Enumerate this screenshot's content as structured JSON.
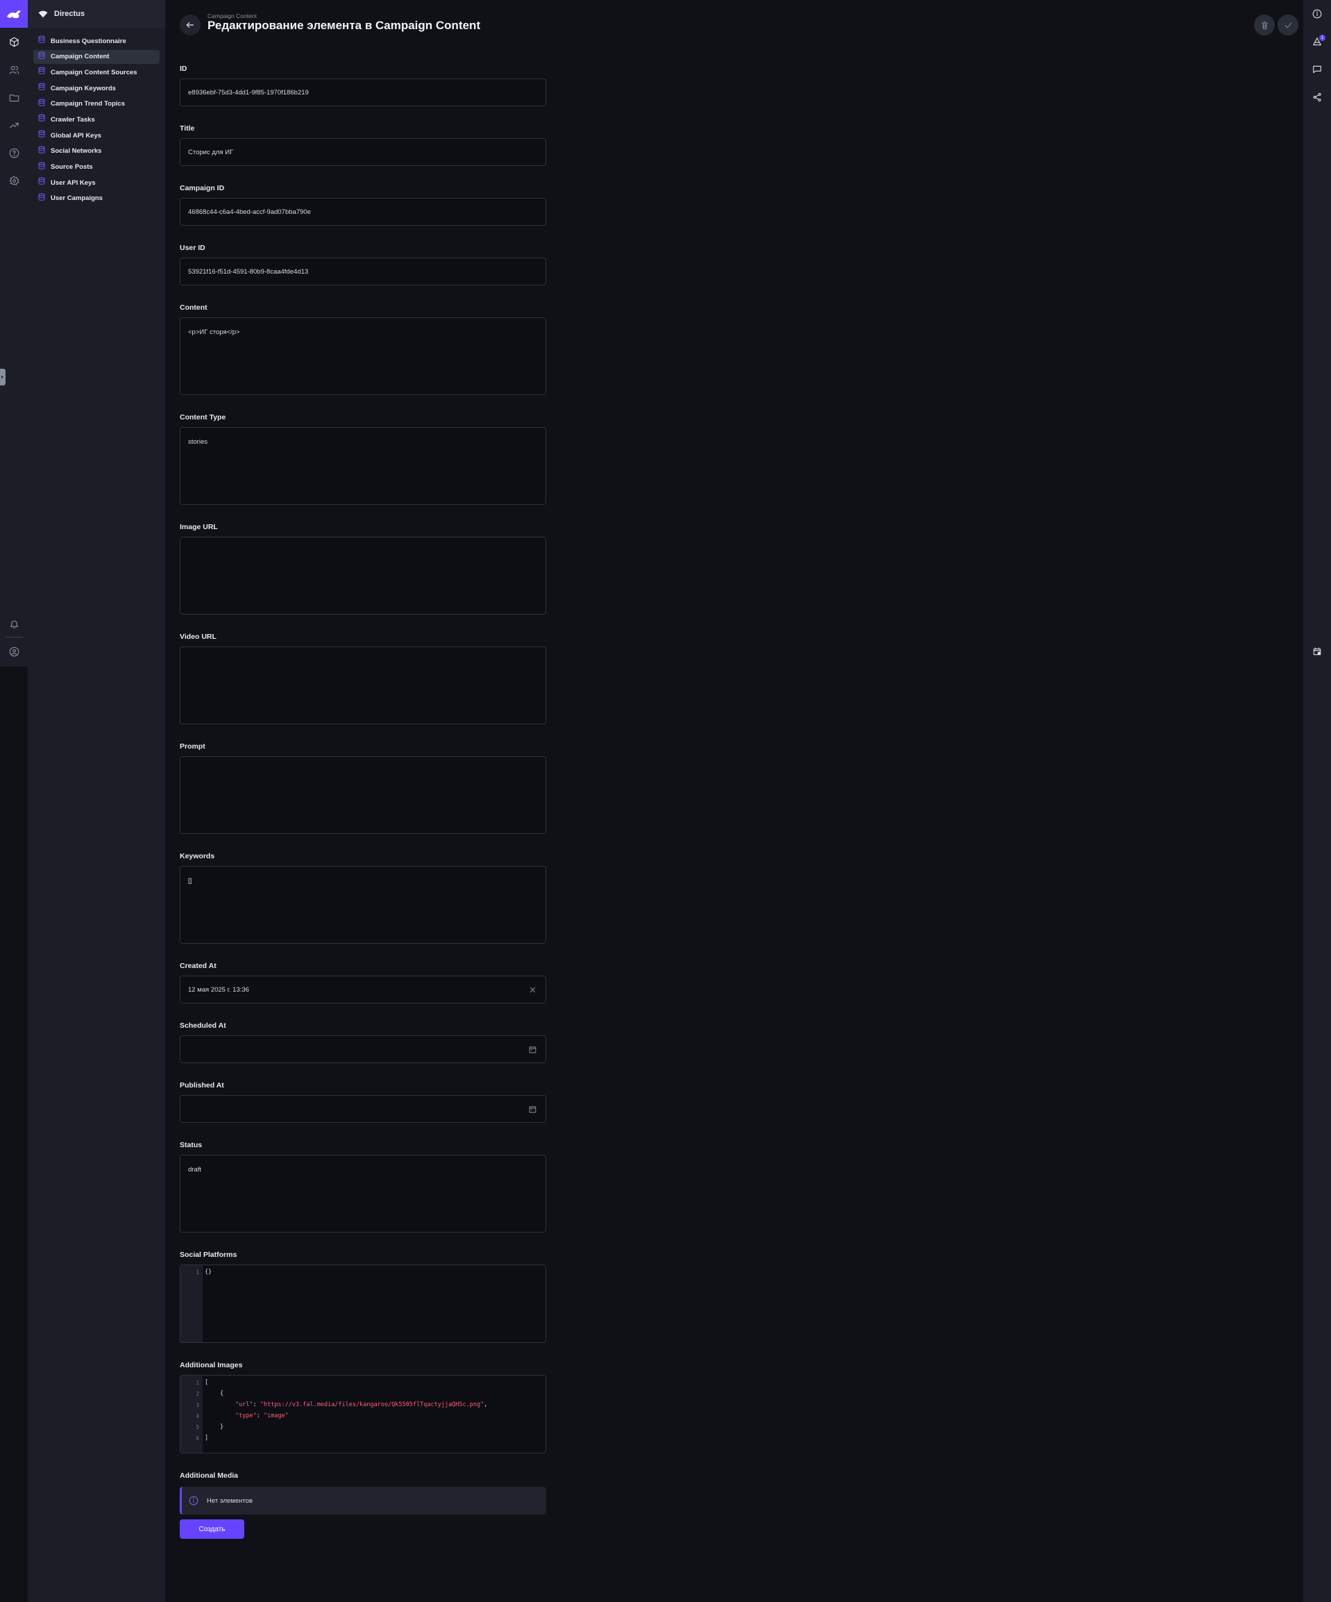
{
  "app": {
    "project_name": "Directus"
  },
  "nav": {
    "items": [
      {
        "label": "Business Questionnaire",
        "active": false
      },
      {
        "label": "Campaign Content",
        "active": true
      },
      {
        "label": "Campaign Content Sources",
        "active": false
      },
      {
        "label": "Campaign Keywords",
        "active": false
      },
      {
        "label": "Campaign Trend Topics",
        "active": false
      },
      {
        "label": "Crawler Tasks",
        "active": false
      },
      {
        "label": "Global API Keys",
        "active": false
      },
      {
        "label": "Social Networks",
        "active": false
      },
      {
        "label": "Source Posts",
        "active": false
      },
      {
        "label": "User API Keys",
        "active": false
      },
      {
        "label": "User Campaigns",
        "active": false
      }
    ]
  },
  "header": {
    "breadcrumb": "Campaign Content",
    "title": "Редактирование элемента в Campaign Content"
  },
  "right_sidebar": {
    "revisions_badge": "1"
  },
  "form": {
    "id": {
      "label": "ID",
      "value": "e8936ebf-75d3-4dd1-9f85-1970f186b219"
    },
    "title": {
      "label": "Title",
      "value": "Сторис для ИГ"
    },
    "campaign_id": {
      "label": "Campaign ID",
      "value": "46868c44-c6a4-4bed-accf-9ad07bba790e"
    },
    "user_id": {
      "label": "User ID",
      "value": "53921f16-f51d-4591-80b9-8caa4fde4d13"
    },
    "content": {
      "label": "Content",
      "value": "<p>ИГ сторя</p>"
    },
    "content_type": {
      "label": "Content Type",
      "value": "stories"
    },
    "image_url": {
      "label": "Image URL",
      "value": ""
    },
    "video_url": {
      "label": "Video URL",
      "value": ""
    },
    "prompt": {
      "label": "Prompt",
      "value": ""
    },
    "keywords": {
      "label": "Keywords",
      "value": "[]"
    },
    "created_at": {
      "label": "Created At",
      "value": "12 мая 2025 г. 13:36"
    },
    "scheduled_at": {
      "label": "Scheduled At",
      "value": ""
    },
    "published_at": {
      "label": "Published At",
      "value": ""
    },
    "status": {
      "label": "Status",
      "value": "draft"
    },
    "social_platforms": {
      "label": "Social Platforms",
      "line_numbers": [
        "1"
      ],
      "lines": [
        "{}"
      ]
    },
    "additional_images": {
      "label": "Additional Images",
      "line_numbers": [
        "1",
        "2",
        "3",
        "4",
        "5",
        "6"
      ],
      "bracket_open": "[",
      "obj_open": "{",
      "url_key": "\"url\"",
      "url_value": "\"https://v3.fal.media/files/kangaroo/Qk5505flTqactyjjaQHSc.png\"",
      "type_key": "\"type\"",
      "type_value": "\"image\"",
      "obj_close": "}",
      "bracket_close": "]"
    },
    "additional_media": {
      "label": "Additional Media",
      "empty_notice": "Нет элементов",
      "create_label": "Создать"
    }
  },
  "colors": {
    "accent": "#6644ff",
    "background": "#0f1117",
    "sidebar": "#1b1e27"
  }
}
